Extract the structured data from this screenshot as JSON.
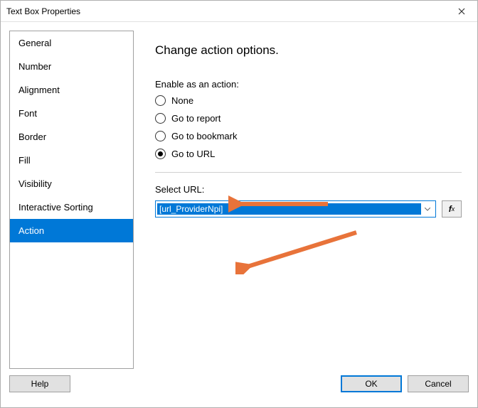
{
  "window": {
    "title": "Text Box Properties"
  },
  "sidebar": {
    "items": [
      {
        "label": "General"
      },
      {
        "label": "Number"
      },
      {
        "label": "Alignment"
      },
      {
        "label": "Font"
      },
      {
        "label": "Border"
      },
      {
        "label": "Fill"
      },
      {
        "label": "Visibility"
      },
      {
        "label": "Interactive Sorting"
      },
      {
        "label": "Action"
      }
    ],
    "selected_index": 8
  },
  "panel": {
    "heading": "Change action options.",
    "enable_label": "Enable as an action:",
    "options": [
      {
        "label": "None"
      },
      {
        "label": "Go to report"
      },
      {
        "label": "Go to bookmark"
      },
      {
        "label": "Go to URL"
      }
    ],
    "selected_option": 3,
    "select_url_label": "Select URL:",
    "url_value": "[url_ProviderNpi]",
    "fx_label": "fx"
  },
  "footer": {
    "help": "Help",
    "ok": "OK",
    "cancel": "Cancel"
  }
}
